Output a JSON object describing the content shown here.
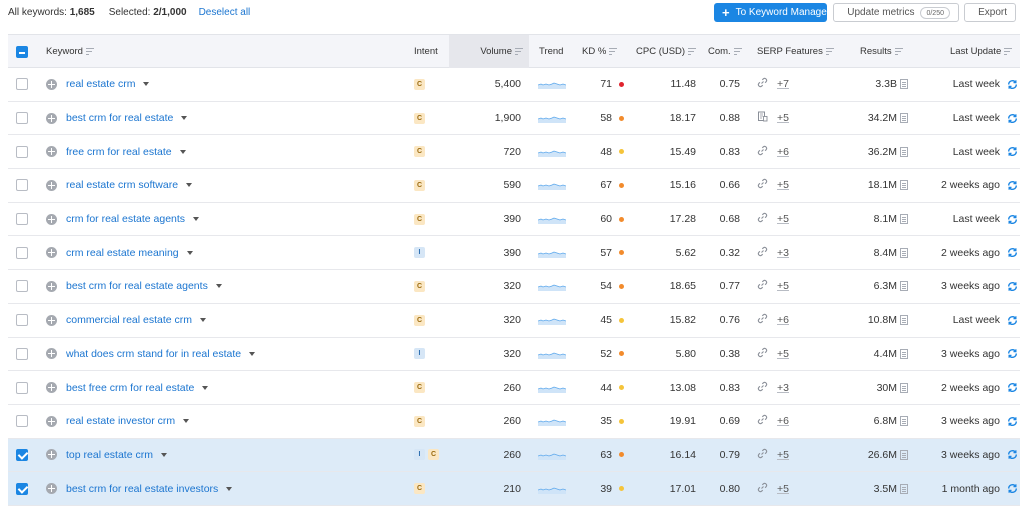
{
  "topbar": {
    "all_keywords_label": "All keywords:",
    "all_keywords_count": "1,685",
    "selected_label": "Selected:",
    "selected_count": "2/1,000",
    "deselect_label": "Deselect all",
    "keyword_manager_label": "To Keyword Manager",
    "update_metrics_label": "Update metrics",
    "update_metrics_quota": "0/250",
    "export_label": "Export"
  },
  "columns": {
    "keyword": "Keyword",
    "intent": "Intent",
    "volume": "Volume",
    "trend": "Trend",
    "kd": "KD %",
    "cpc": "CPC (USD)",
    "com": "Com.",
    "serp": "SERP Features",
    "results": "Results",
    "last_update": "Last Update"
  },
  "colors": {
    "accent": "#1b86e3",
    "kd_red": "#e0242e",
    "kd_orange": "#f28b2c",
    "kd_yellow": "#f5c43a",
    "selected_row": "#ddebf8"
  },
  "rows": [
    {
      "checked": false,
      "keyword": "real estate crm",
      "intent": [
        "C"
      ],
      "volume": "5,400",
      "kd": "71",
      "kd_color": "#e0242e",
      "cpc": "11.48",
      "com": "0.75",
      "serp_icon": "link-icon",
      "serp_more": "+7",
      "results": "3.3B",
      "last_update": "Last week"
    },
    {
      "checked": false,
      "keyword": "best crm for real estate",
      "intent": [
        "C"
      ],
      "volume": "1,900",
      "kd": "58",
      "kd_color": "#f28b2c",
      "cpc": "18.17",
      "com": "0.88",
      "serp_icon": "review-icon",
      "serp_more": "+5",
      "results": "34.2M",
      "last_update": "Last week"
    },
    {
      "checked": false,
      "keyword": "free crm for real estate",
      "intent": [
        "C"
      ],
      "volume": "720",
      "kd": "48",
      "kd_color": "#f5c43a",
      "cpc": "15.49",
      "com": "0.83",
      "serp_icon": "link-icon",
      "serp_more": "+6",
      "results": "36.2M",
      "last_update": "Last week"
    },
    {
      "checked": false,
      "keyword": "real estate crm software",
      "intent": [
        "C"
      ],
      "volume": "590",
      "kd": "67",
      "kd_color": "#f28b2c",
      "cpc": "15.16",
      "com": "0.66",
      "serp_icon": "link-icon",
      "serp_more": "+5",
      "results": "18.1M",
      "last_update": "2 weeks ago"
    },
    {
      "checked": false,
      "keyword": "crm for real estate agents",
      "intent": [
        "C"
      ],
      "volume": "390",
      "kd": "60",
      "kd_color": "#f28b2c",
      "cpc": "17.28",
      "com": "0.68",
      "serp_icon": "link-icon",
      "serp_more": "+5",
      "results": "8.1M",
      "last_update": "Last week"
    },
    {
      "checked": false,
      "keyword": "crm real estate meaning",
      "intent": [
        "I"
      ],
      "volume": "390",
      "kd": "57",
      "kd_color": "#f28b2c",
      "cpc": "5.62",
      "com": "0.32",
      "serp_icon": "link-icon",
      "serp_more": "+3",
      "results": "8.4M",
      "last_update": "2 weeks ago"
    },
    {
      "checked": false,
      "keyword": "best crm for real estate agents",
      "intent": [
        "C"
      ],
      "volume": "320",
      "kd": "54",
      "kd_color": "#f28b2c",
      "cpc": "18.65",
      "com": "0.77",
      "serp_icon": "link-icon",
      "serp_more": "+5",
      "results": "6.3M",
      "last_update": "3 weeks ago"
    },
    {
      "checked": false,
      "keyword": "commercial real estate crm",
      "intent": [
        "C"
      ],
      "volume": "320",
      "kd": "45",
      "kd_color": "#f5c43a",
      "cpc": "15.82",
      "com": "0.76",
      "serp_icon": "link-icon",
      "serp_more": "+6",
      "results": "10.8M",
      "last_update": "Last week"
    },
    {
      "checked": false,
      "keyword": "what does crm stand for in real estate",
      "intent": [
        "I"
      ],
      "volume": "320",
      "kd": "52",
      "kd_color": "#f28b2c",
      "cpc": "5.80",
      "com": "0.38",
      "serp_icon": "link-icon",
      "serp_more": "+5",
      "results": "4.4M",
      "last_update": "3 weeks ago"
    },
    {
      "checked": false,
      "keyword": "best free crm for real estate",
      "intent": [
        "C"
      ],
      "volume": "260",
      "kd": "44",
      "kd_color": "#f5c43a",
      "cpc": "13.08",
      "com": "0.83",
      "serp_icon": "link-icon",
      "serp_more": "+3",
      "results": "30M",
      "last_update": "2 weeks ago"
    },
    {
      "checked": false,
      "keyword": "real estate investor crm",
      "intent": [
        "C"
      ],
      "volume": "260",
      "kd": "35",
      "kd_color": "#f5c43a",
      "cpc": "19.91",
      "com": "0.69",
      "serp_icon": "link-icon",
      "serp_more": "+6",
      "results": "6.8M",
      "last_update": "3 weeks ago"
    },
    {
      "checked": true,
      "keyword": "top real estate crm",
      "intent": [
        "I",
        "C"
      ],
      "volume": "260",
      "kd": "63",
      "kd_color": "#f28b2c",
      "cpc": "16.14",
      "com": "0.79",
      "serp_icon": "link-icon",
      "serp_more": "+5",
      "results": "26.6M",
      "last_update": "3 weeks ago"
    },
    {
      "checked": true,
      "keyword": "best crm for real estate investors",
      "intent": [
        "C"
      ],
      "volume": "210",
      "kd": "39",
      "kd_color": "#f5c43a",
      "cpc": "17.01",
      "com": "0.80",
      "serp_icon": "link-icon",
      "serp_more": "+5",
      "results": "3.5M",
      "last_update": "1 month ago"
    }
  ]
}
